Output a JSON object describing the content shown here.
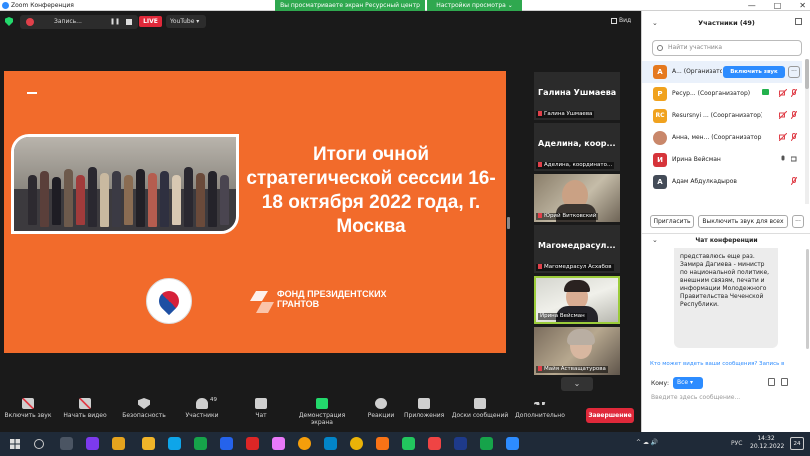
{
  "window": {
    "title": "Zoom Конференция",
    "share_banner": "Вы просматриваете экран Ресурсный центр",
    "view_options": "Настройки просмотра ⌄",
    "controls": [
      "—",
      "□",
      "✕"
    ]
  },
  "topbar": {
    "recording_label": "Запись...",
    "pause_glyph": "❚❚",
    "live_label": "LIVE",
    "youtube_label": "YouTube ▾",
    "view_label": "Вид"
  },
  "slide": {
    "title": "Итоги очной стратегической сессии 16-18 октября 2022 года, г. Москва",
    "fund_name": "ФОНД ПРЕЗИДЕНТСКИХ ГРАНТОВ"
  },
  "tiles": [
    {
      "big": "Галина Ушмаева",
      "label": "Галина Ушмаева"
    },
    {
      "big": "Аделина, коор...",
      "label": "Аделина, координато..."
    },
    {
      "big": "",
      "label": "Юрий Витковский"
    },
    {
      "big": "Магомедрасул...",
      "label": "Магомедрасул Асхабов"
    },
    {
      "big": "",
      "label": "Ирина Вейсман"
    },
    {
      "big": "",
      "label": "Майя Астващатурова"
    }
  ],
  "scroll_down_glyph": "⌄",
  "toolbar": {
    "items": [
      {
        "label": "Включить звук"
      },
      {
        "label": "Начать видео"
      },
      {
        "label": "Безопасность"
      },
      {
        "label": "Участники",
        "count": "49"
      },
      {
        "label": "Чат"
      },
      {
        "label": "Демонстрация экрана"
      },
      {
        "label": "Реакции"
      },
      {
        "label": "Приложения"
      },
      {
        "label": "Доски сообщений"
      },
      {
        "label": "Дополнительно"
      }
    ],
    "end_label": "Завершение"
  },
  "participants": {
    "header": "Участники (49)",
    "collapse_glyph": "⌄",
    "search_placeholder": "Найти участника",
    "unmute_label": "Включить звук",
    "more_glyph": "···",
    "rows": [
      {
        "initial": "А",
        "color": "#e5791f",
        "name": "А... (Организатор)"
      },
      {
        "initial": "Р",
        "color": "#f0a21e",
        "name": "Ресур... (Соорганизатор)"
      },
      {
        "initial": "RC",
        "color": "#f0a21e",
        "name": "Resursnyi ... (Соорганизатор)"
      },
      {
        "initial": "",
        "color": "#c9876a",
        "name": "Анна, мен... (Соорганизатор)"
      },
      {
        "initial": "И",
        "color": "#d6343a",
        "name": "Ирина Вейсман"
      },
      {
        "initial": "А",
        "color": "#444c58",
        "name": "Адам Абдулкадыров"
      }
    ],
    "invite_label": "Пригласить",
    "unmute_all_label": "Выключить звук для всех"
  },
  "chat": {
    "header": "Чат конференции",
    "collapse_glyph": "⌄",
    "message": "представлюсь еще раз. Замира Дагиева - министр по национальной политике, внешним связям, печати и информации Молодежного Правительства Чеченской Республики.",
    "who_sees": "Кто может видеть ваши сообщения? Запись в",
    "to_label": "Кому:",
    "to_value": "Все ▾",
    "input_placeholder": "Введите здесь сообщение..."
  },
  "taskbar": {
    "tray": "^ ☁ 🔊",
    "lang": "РУС",
    "time": "14:32",
    "date": "20.12.2022",
    "notifications": "24"
  },
  "colors": {
    "slide_orange": "#f26b2b",
    "zoom_blue": "#2d8cff",
    "end_red": "#e0293a",
    "banner_green": "#2fa84f"
  }
}
